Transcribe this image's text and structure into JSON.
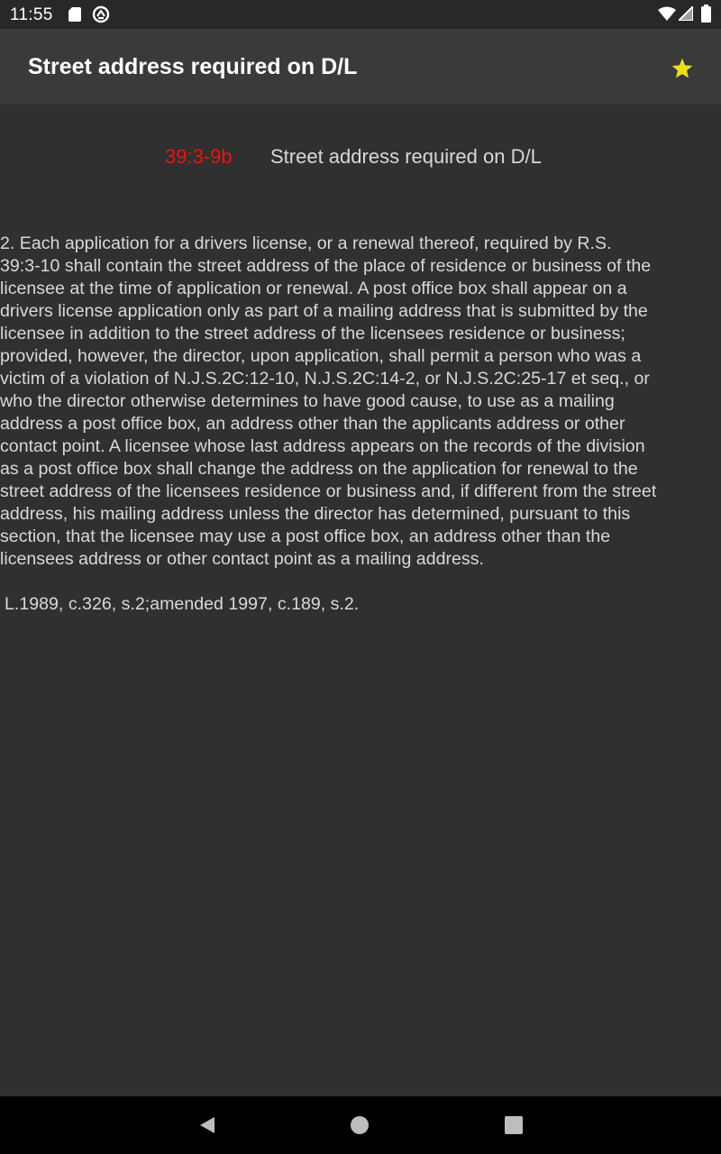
{
  "status_bar": {
    "time": "11:55",
    "icons": [
      "sd-card-icon",
      "sync-icon",
      "wifi-icon",
      "cell-signal-icon",
      "battery-icon"
    ]
  },
  "app_bar": {
    "title": "Street address required on D/L",
    "favorite_icon": "star-icon",
    "favorite_color": "#e8e01c"
  },
  "section": {
    "number": "39:3-9b",
    "number_color": "#ee1111",
    "title": "Street address required on D/L",
    "body": "   2.  Each application for a drivers license, or a renewal thereof, required by R.S.\n39:3-10 shall contain the street address of the place of residence or business of the\nlicensee at the time of application or renewal.  A post office box shall appear on a\ndrivers license application only as part of a mailing address that is submitted by the\nlicensee in addition to the street address of the licensees residence or business;\nprovided, however, the director, upon application, shall permit a person who was a\nvictim of a violation of N.J.S.2C:12-10, N.J.S.2C:14-2, or N.J.S.2C:25-17 et seq., or\nwho the director otherwise determines to have good cause, to use as a mailing\naddress a post office box, an address other than the applicants address or other\ncontact point.  A licensee whose last address appears on the records of the division\nas a post office box shall change the address on the application for renewal to the\nstreet address of the licensees residence or business and, if different from the street\naddress, his mailing address unless the director has determined, pursuant to this\nsection, that the licensee may use a post office box, an address other than the\nlicensees address or other contact point as a mailing address.",
    "history": "L.1989, c.326, s.2;amended 1997, c.189, s.2."
  },
  "nav_bar": {
    "back_icon": "back-triangle-icon",
    "home_icon": "home-circle-icon",
    "recents_icon": "recents-square-icon"
  }
}
